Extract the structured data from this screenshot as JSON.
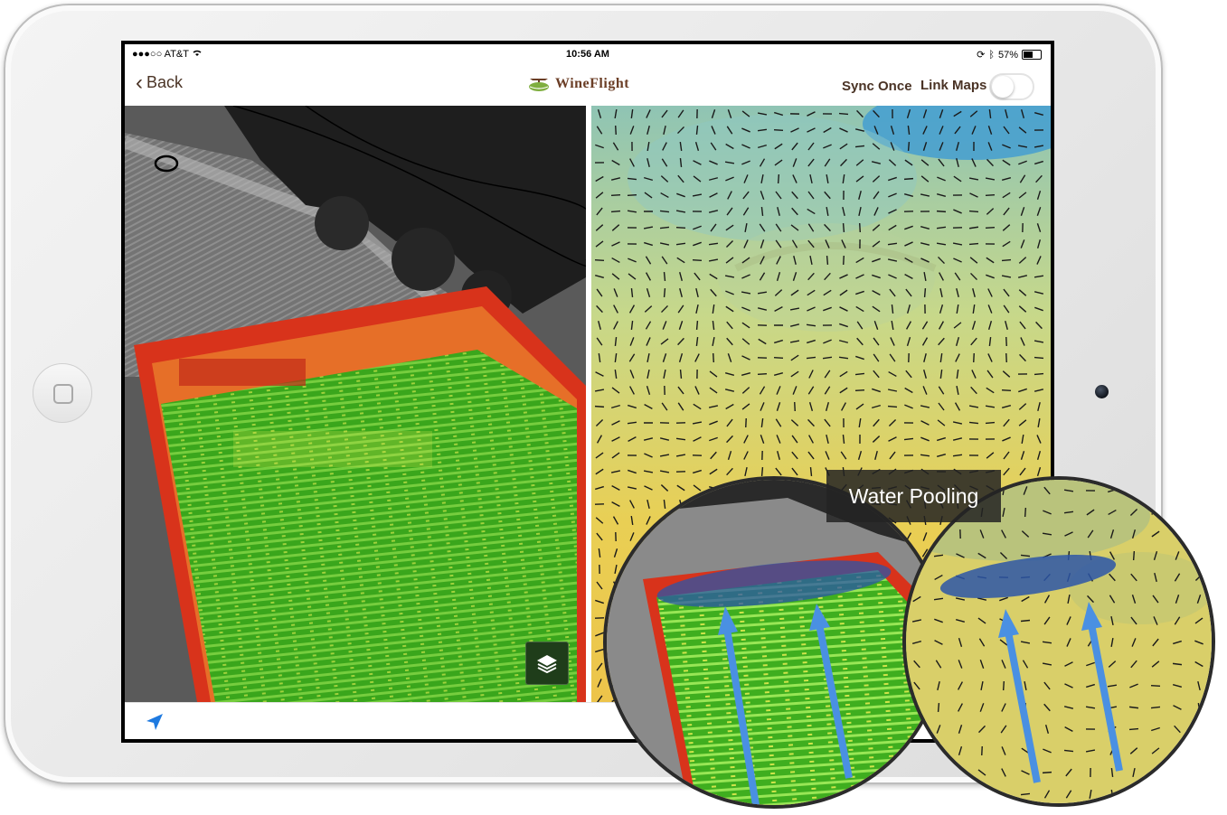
{
  "status_bar": {
    "carrier": "●●●○○ AT&T",
    "time": "10:56 AM",
    "battery": "57%"
  },
  "nav": {
    "back_label": "Back",
    "app_name": "WineFlight",
    "sync_label": "Sync Once",
    "link_maps_label": "Link Maps",
    "link_maps_on": false
  },
  "callout": {
    "label": "Water Pooling"
  },
  "colors": {
    "brand": "#6b3e26",
    "nav_text": "#4a3325",
    "link_blue": "#1e7ae0",
    "ndvi_green": "#5fd12d",
    "ndvi_red": "#d8331b",
    "arrow_blue": "#4a90e2",
    "pool_blue": "#2b56a8"
  },
  "icons": {
    "back": "chevron-left-icon",
    "layers": "layers-icon",
    "locate": "location-arrow-icon",
    "wifi": "wifi-icon",
    "bluetooth": "bluetooth-icon",
    "battery": "battery-icon"
  }
}
